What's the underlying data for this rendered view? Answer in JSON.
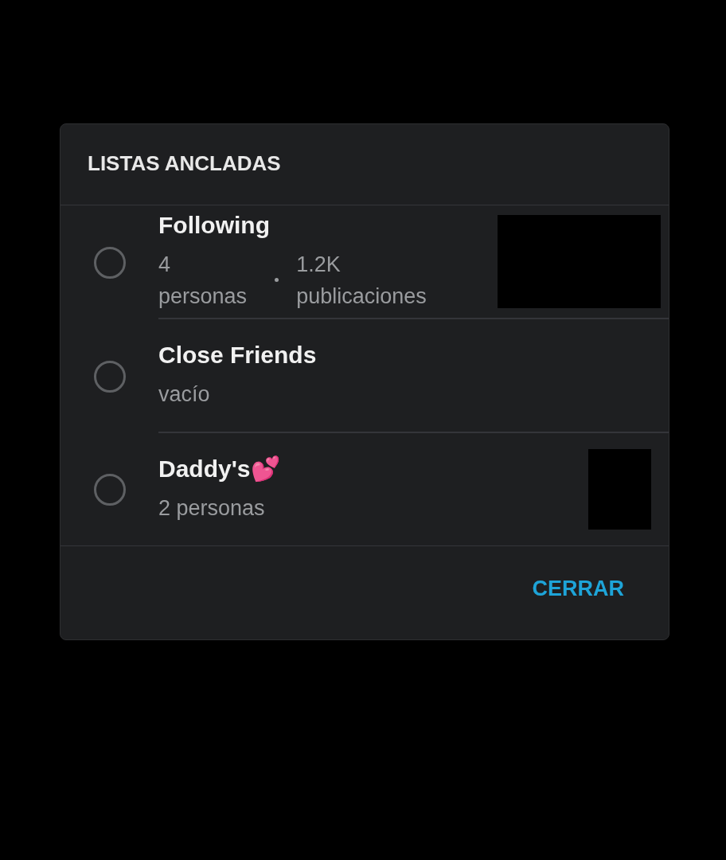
{
  "dialog": {
    "title": "LISTAS ANCLADAS",
    "lists": [
      {
        "name": "Following",
        "selected": false,
        "meta": [
          "4 personas",
          "1.2K publicaciones"
        ],
        "kind": "wide"
      },
      {
        "name": "Close Friends",
        "selected": false,
        "meta": [
          "vacío"
        ],
        "kind": "plain"
      },
      {
        "name": "Daddy's💕",
        "selected": false,
        "meta": [
          "2 personas"
        ],
        "kind": "narrow"
      }
    ],
    "close_button": "CERRAR"
  }
}
